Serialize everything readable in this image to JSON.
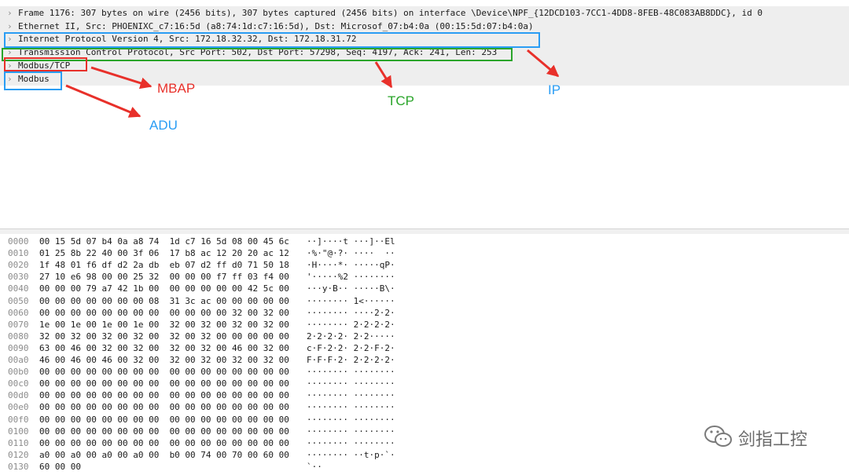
{
  "details": {
    "rows": [
      {
        "text": "Frame 1176: 307 bytes on wire (2456 bits), 307 bytes captured (2456 bits) on interface \\Device\\NPF_{12DCD103-7CC1-4DD8-8FEB-48C083AB8DDC}, id 0"
      },
      {
        "text": "Ethernet II, Src: PHOENIXC_c7:16:5d (a8:74:1d:c7:16:5d), Dst: Microsof_07:b4:0a (00:15:5d:07:b4:0a)"
      },
      {
        "text": "Internet Protocol Version 4, Src: 172.18.32.32, Dst: 172.18.31.72"
      },
      {
        "text": "Transmission Control Protocol, Src Port: 502, Dst Port: 57298, Seq: 4197, Ack: 241, Len: 253"
      },
      {
        "text": "Modbus/TCP"
      },
      {
        "text": "Modbus"
      }
    ],
    "chevron": "chevron-right-icon"
  },
  "hex": {
    "rows": [
      {
        "offset": "0000",
        "hex": "00 15 5d 07 b4 0a a8 74  1d c7 16 5d 08 00 45 6c",
        "ascii": "··]····t ···]··El"
      },
      {
        "offset": "0010",
        "hex": "01 25 8b 22 40 00 3f 06  17 b8 ac 12 20 20 ac 12",
        "ascii": "·%·\"@·?· ····  ··"
      },
      {
        "offset": "0020",
        "hex": "1f 48 01 f6 df d2 2a db  eb 07 d2 ff d0 71 50 18",
        "ascii": "·H····*· ·····qP·"
      },
      {
        "offset": "0030",
        "hex": "27 10 e6 98 00 00 25 32  00 00 00 f7 ff 03 f4 00",
        "ascii": "'·····%2 ········"
      },
      {
        "offset": "0040",
        "hex": "00 00 00 79 a7 42 1b 00  00 00 00 00 00 42 5c 00",
        "ascii": "···y·B·· ·····B\\·"
      },
      {
        "offset": "0050",
        "hex": "00 00 00 00 00 00 00 08  31 3c ac 00 00 00 00 00",
        "ascii": "········ 1<······"
      },
      {
        "offset": "0060",
        "hex": "00 00 00 00 00 00 00 00  00 00 00 00 32 00 32 00",
        "ascii": "········ ····2·2·"
      },
      {
        "offset": "0070",
        "hex": "1e 00 1e 00 1e 00 1e 00  32 00 32 00 32 00 32 00",
        "ascii": "········ 2·2·2·2·"
      },
      {
        "offset": "0080",
        "hex": "32 00 32 00 32 00 32 00  32 00 32 00 00 00 00 00",
        "ascii": "2·2·2·2· 2·2·····"
      },
      {
        "offset": "0090",
        "hex": "63 00 46 00 32 00 32 00  32 00 32 00 46 00 32 00",
        "ascii": "c·F·2·2· 2·2·F·2·"
      },
      {
        "offset": "00a0",
        "hex": "46 00 46 00 46 00 32 00  32 00 32 00 32 00 32 00",
        "ascii": "F·F·F·2· 2·2·2·2·"
      },
      {
        "offset": "00b0",
        "hex": "00 00 00 00 00 00 00 00  00 00 00 00 00 00 00 00",
        "ascii": "········ ········"
      },
      {
        "offset": "00c0",
        "hex": "00 00 00 00 00 00 00 00  00 00 00 00 00 00 00 00",
        "ascii": "········ ········"
      },
      {
        "offset": "00d0",
        "hex": "00 00 00 00 00 00 00 00  00 00 00 00 00 00 00 00",
        "ascii": "········ ········"
      },
      {
        "offset": "00e0",
        "hex": "00 00 00 00 00 00 00 00  00 00 00 00 00 00 00 00",
        "ascii": "········ ········"
      },
      {
        "offset": "00f0",
        "hex": "00 00 00 00 00 00 00 00  00 00 00 00 00 00 00 00",
        "ascii": "········ ········"
      },
      {
        "offset": "0100",
        "hex": "00 00 00 00 00 00 00 00  00 00 00 00 00 00 00 00",
        "ascii": "········ ········"
      },
      {
        "offset": "0110",
        "hex": "00 00 00 00 00 00 00 00  00 00 00 00 00 00 00 00",
        "ascii": "········ ········"
      },
      {
        "offset": "0120",
        "hex": "a0 00 a0 00 a0 00 a0 00  b0 00 74 00 70 00 60 00",
        "ascii": "········ ··t·p·`·"
      },
      {
        "offset": "0130",
        "hex": "60 00 00",
        "ascii": "`··"
      }
    ]
  },
  "annotations": {
    "mbap": {
      "label": "MBAP",
      "color": "#e8302a"
    },
    "adu": {
      "label": "ADU",
      "color": "#2a9df4"
    },
    "tcp": {
      "label": "TCP",
      "color": "#2aa52a"
    },
    "ip": {
      "label": "IP",
      "color": "#2a9df4"
    }
  },
  "watermark": {
    "text": "剑指工控",
    "icon": "wechat-icon"
  }
}
